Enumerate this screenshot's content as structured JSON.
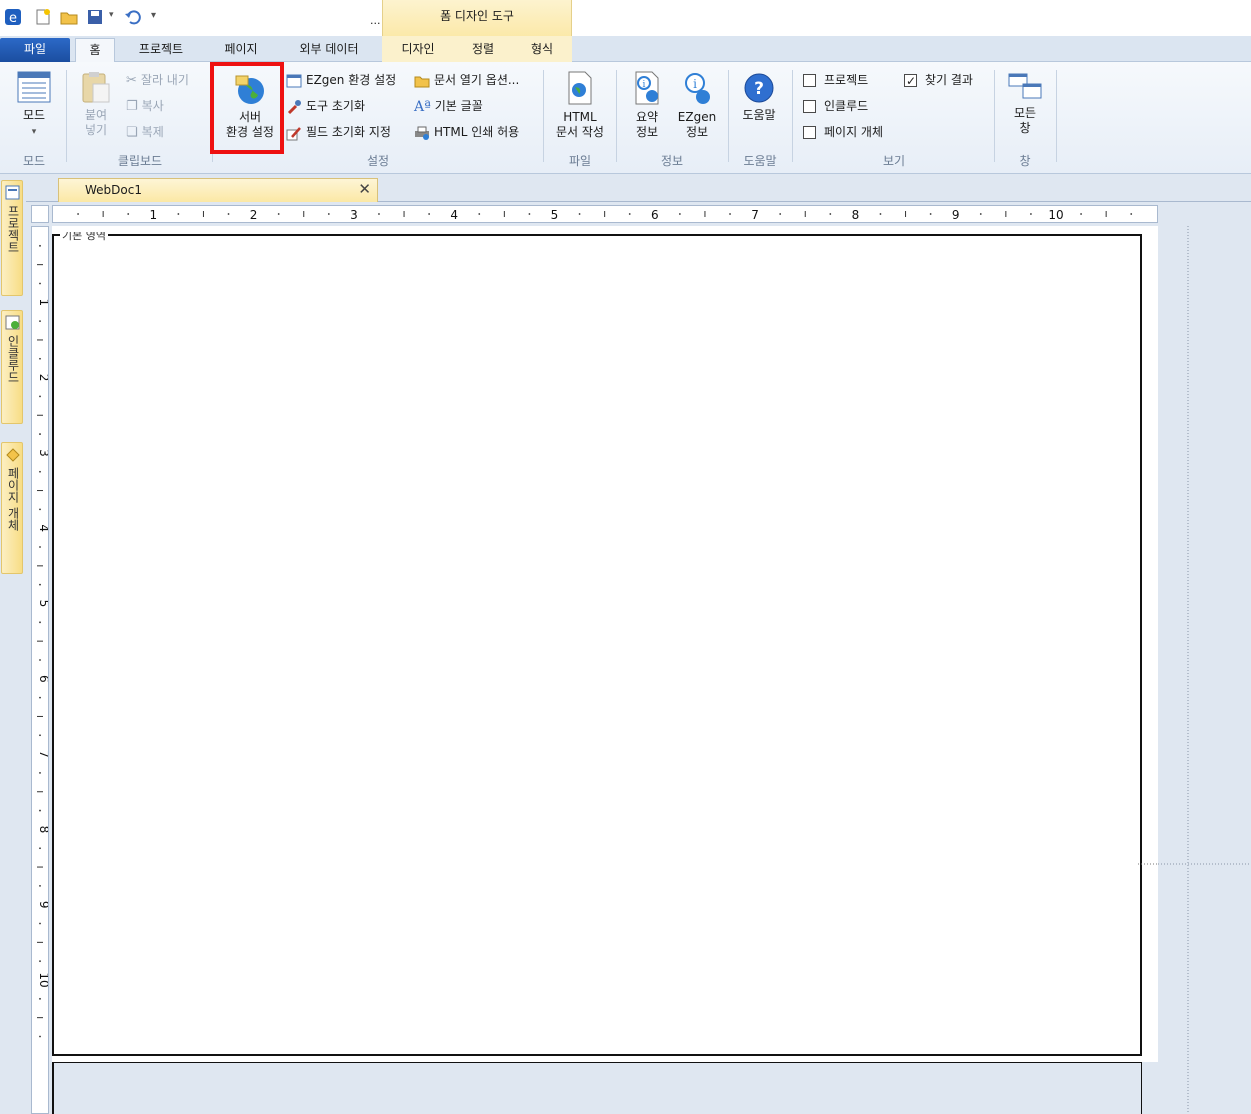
{
  "qat": {
    "more_label": "...",
    "icons": [
      "app-logo-icon",
      "new-document-icon",
      "open-folder-icon",
      "save-icon",
      "undo-icon",
      "customize-dropdown-icon"
    ]
  },
  "context_tab_group": {
    "label": "폼 디자인 도구"
  },
  "tabs": {
    "file": "파일",
    "home": "홈",
    "project": "프로젝트",
    "page": "페이지",
    "external_data": "외부 데이터",
    "design": "디자인",
    "arrange": "정렬",
    "format": "형식"
  },
  "ribbon": {
    "mode": {
      "button": "모드",
      "group": "모드"
    },
    "clipboard": {
      "paste_line1": "붙여",
      "paste_line2": "넣기",
      "cut": "잘라 내기",
      "copy": "복사",
      "duplicate": "복제",
      "group": "클립보드"
    },
    "settings": {
      "server_line1": "서버",
      "server_line2": "환경 설정",
      "ezgen_env": "EZgen 환경 설정",
      "tool_reset": "도구 초기화",
      "field_reset": "필드 초기화 지정",
      "doc_open_options": "문서 열기 옵션...",
      "default_font": "기본 글꼴",
      "html_print": "HTML 인쇄 허용",
      "group": "설정"
    },
    "file": {
      "html_line1": "HTML",
      "html_line2": "문서 작성",
      "group": "파일"
    },
    "info": {
      "summary_line1": "요약",
      "summary_line2": "정보",
      "ezgen_line1": "EZgen",
      "ezgen_line2": "정보",
      "group": "정보"
    },
    "help": {
      "button": "도움말",
      "group": "도움말"
    },
    "view": {
      "project": "프로젝트",
      "find_results": "찾기 결과",
      "include": "인클루드",
      "page_objects": "페이지 개체",
      "group": "보기"
    },
    "window": {
      "all_line1": "모든",
      "all_line2": "창",
      "group": "창"
    }
  },
  "side_panes": {
    "project": "프로젝트",
    "include": "인클루드",
    "page_objects": "페이지 개체"
  },
  "document": {
    "tab_label": "WebDoc1",
    "close_glyph": "✕",
    "page_label": "기본 영역"
  },
  "ruler": {
    "h_numbers": [
      "1",
      "2",
      "3",
      "4",
      "5",
      "6",
      "7",
      "8",
      "9",
      "10"
    ],
    "v_numbers": [
      "1",
      "2",
      "3",
      "4",
      "5",
      "6",
      "7",
      "8",
      "9",
      "10"
    ]
  },
  "view_checks": {
    "project": false,
    "find_results": true,
    "include": false,
    "page_objects": false
  }
}
